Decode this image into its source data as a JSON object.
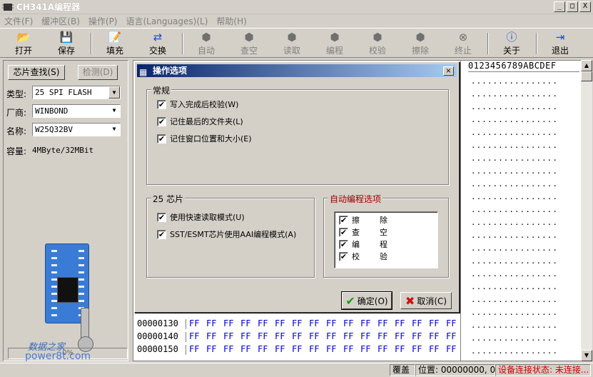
{
  "window": {
    "title": "CH341A编程器",
    "btn_min": "_",
    "btn_max": "□",
    "btn_close": "X"
  },
  "menu": [
    "文件(F)",
    "缓冲区(B)",
    "操作(P)",
    "语言(Languages)(L)",
    "帮助(H)"
  ],
  "toolbar": [
    {
      "label": "打开",
      "icon": "📂",
      "enabled": true
    },
    {
      "label": "保存",
      "icon": "💾",
      "enabled": true
    },
    {
      "label": "填充",
      "icon": "📝",
      "enabled": true
    },
    {
      "label": "交换",
      "icon": "⇄",
      "enabled": true
    },
    {
      "label": "自动",
      "icon": "⬢",
      "enabled": false
    },
    {
      "label": "查空",
      "icon": "⬢",
      "enabled": false
    },
    {
      "label": "读取",
      "icon": "⬢",
      "enabled": false
    },
    {
      "label": "编程",
      "icon": "⬢",
      "enabled": false
    },
    {
      "label": "校验",
      "icon": "⬢",
      "enabled": false
    },
    {
      "label": "擦除",
      "icon": "⬢",
      "enabled": false
    },
    {
      "label": "终止",
      "icon": "⊗",
      "enabled": false
    },
    {
      "label": "关于",
      "icon": "ⓘ",
      "enabled": true
    },
    {
      "label": "退出",
      "icon": "⇥",
      "enabled": true
    }
  ],
  "left": {
    "find_chip": "芯片查找(S)",
    "detect": "检测(D)",
    "type_label": "类型:",
    "type_value": "25 SPI FLASH",
    "vendor_label": "厂商:",
    "vendor_value": "WINBOND",
    "name_label": "名称:",
    "name_value": "W25Q32BV",
    "capacity_label": "容量:",
    "capacity_value": "4MByte/32MBit",
    "progress_text": "0%",
    "progress": 0,
    "watermark1": "数据之家",
    "watermark2": "power8t.com"
  },
  "hex": {
    "ascii_header": "0123456789ABCDEF",
    "dots": "................",
    "rows": [
      {
        "addr": "00000130",
        "bytes": [
          "FF",
          "FF",
          "FF",
          "FF",
          "FF",
          "FF",
          "FF",
          "FF",
          "FF",
          "FF",
          "FF",
          "FF",
          "FF",
          "FF",
          "FF",
          "FF"
        ]
      },
      {
        "addr": "00000140",
        "bytes": [
          "FF",
          "FF",
          "FF",
          "FF",
          "FF",
          "FF",
          "FF",
          "FF",
          "FF",
          "FF",
          "FF",
          "FF",
          "FF",
          "FF",
          "FF",
          "FF"
        ]
      },
      {
        "addr": "00000150",
        "bytes": [
          "FF",
          "FF",
          "FF",
          "FF",
          "FF",
          "FF",
          "FF",
          "FF",
          "FF",
          "FF",
          "FF",
          "FF",
          "FF",
          "FF",
          "FF",
          "FF"
        ]
      }
    ]
  },
  "dialog": {
    "title": "操作选项",
    "close": "×",
    "general_group": "常规",
    "general": [
      {
        "label": "写入完成后校验(W)",
        "checked": true
      },
      {
        "label": "记住最后的文件夹(L)",
        "checked": true
      },
      {
        "label": "记住窗口位置和大小(E)",
        "checked": true
      }
    ],
    "chip25_group": "25 芯片",
    "chip25": [
      {
        "label": "使用快速读取模式(U)",
        "checked": true
      },
      {
        "label": "SST/ESMT芯片使用AAI编程模式(A)",
        "checked": true
      }
    ],
    "auto_group": "自动编程选项",
    "auto": [
      {
        "label": "擦除",
        "checked": true
      },
      {
        "label": "查空",
        "checked": true
      },
      {
        "label": "编程",
        "checked": true
      },
      {
        "label": "校验",
        "checked": true
      }
    ],
    "ok": "确定(O)",
    "cancel": "取消(C)",
    "check_mark": "✔"
  },
  "status": {
    "mode": "覆盖",
    "position": "位置: 00000000, 0",
    "connection": "设备连接状态: 未连接..."
  },
  "colors": {
    "title_grad_start": "#0a246a",
    "hex_bytes": "#0000cc",
    "status_alert": "#cc0000",
    "group_label_red": "#a00000"
  }
}
